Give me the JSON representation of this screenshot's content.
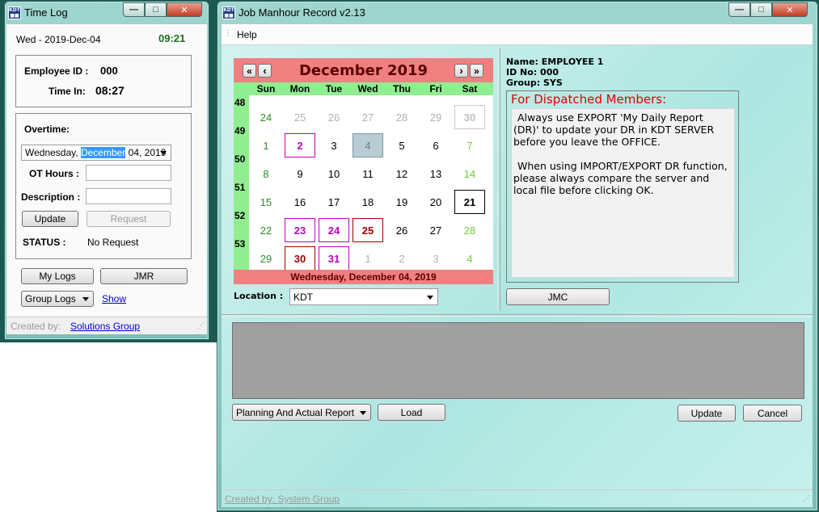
{
  "timelog": {
    "title": "Time Log",
    "date": "Wed - 2019-Dec-04",
    "clock": "09:21",
    "employee_id_label": "Employee ID :",
    "employee_id": "000",
    "time_in_label": "Time In:",
    "time_in": "08:27",
    "overtime_label": "Overtime:",
    "overtime_date_pre": "Wednesday,",
    "overtime_date_month": "December",
    "overtime_date_post": "04, 2019",
    "ot_hours_label": "OT Hours :",
    "description_label": "Description :",
    "update_button": "Update",
    "request_button": "Request",
    "status_label": "STATUS :",
    "status_value": "No Request",
    "my_logs_button": "My Logs",
    "jmr_button": "JMR",
    "group_logs": "Group Logs",
    "show_link": "Show",
    "created_by_label": "Created by:",
    "created_by_link": "Solutions Group"
  },
  "jmr": {
    "title": "Job Manhour Record v2.13",
    "menu_help": "Help",
    "calendar": {
      "month_title": "December 2019",
      "weekdays": [
        "Sun",
        "Mon",
        "Tue",
        "Wed",
        "Thu",
        "Fri",
        "Sat"
      ],
      "weeks": [
        "48",
        "49",
        "50",
        "51",
        "52",
        "53"
      ],
      "days": [
        [
          "24",
          "25",
          "26",
          "27",
          "28",
          "29",
          "30"
        ],
        [
          "1",
          "2",
          "3",
          "4",
          "5",
          "6",
          "7"
        ],
        [
          "8",
          "9",
          "10",
          "11",
          "12",
          "13",
          "14"
        ],
        [
          "15",
          "16",
          "17",
          "18",
          "19",
          "20",
          "21"
        ],
        [
          "22",
          "23",
          "24",
          "25",
          "26",
          "27",
          "28"
        ],
        [
          "29",
          "30",
          "31",
          "1",
          "2",
          "3",
          "4"
        ]
      ],
      "footer": "Wednesday, December 04, 2019",
      "nav_prev_year": "«",
      "nav_prev": "‹",
      "nav_next": "›",
      "nav_next_year": "»"
    },
    "location_label": "Location :",
    "location_value": "KDT",
    "name_line": "Name: EMPLOYEE 1",
    "id_line": "ID No: 000",
    "group_line": "Group: SYS",
    "dispatched_title": "For Dispatched Members:",
    "dispatched_text_1": "Always use EXPORT 'My Daily Report (DR)' to update your DR in KDT SERVER before you leave the OFFICE.",
    "dispatched_text_2": "When using IMPORT/EXPORT DR function, please always compare the server and local file before clicking OK.",
    "jmc_button": "JMC",
    "report_select": "Planning And Actual Report",
    "load_button": "Load",
    "update_button": "Update",
    "cancel_button": "Cancel",
    "created_by": "Created by: System Group"
  },
  "colors": {
    "calendar_header": "#f08080",
    "calendar_weekbar": "#90ee90",
    "dispatched_title": "#e00000",
    "clock": "#1a6e1a",
    "highlight_magenta": "#c000c0",
    "highlight_maroon": "#a00000"
  }
}
